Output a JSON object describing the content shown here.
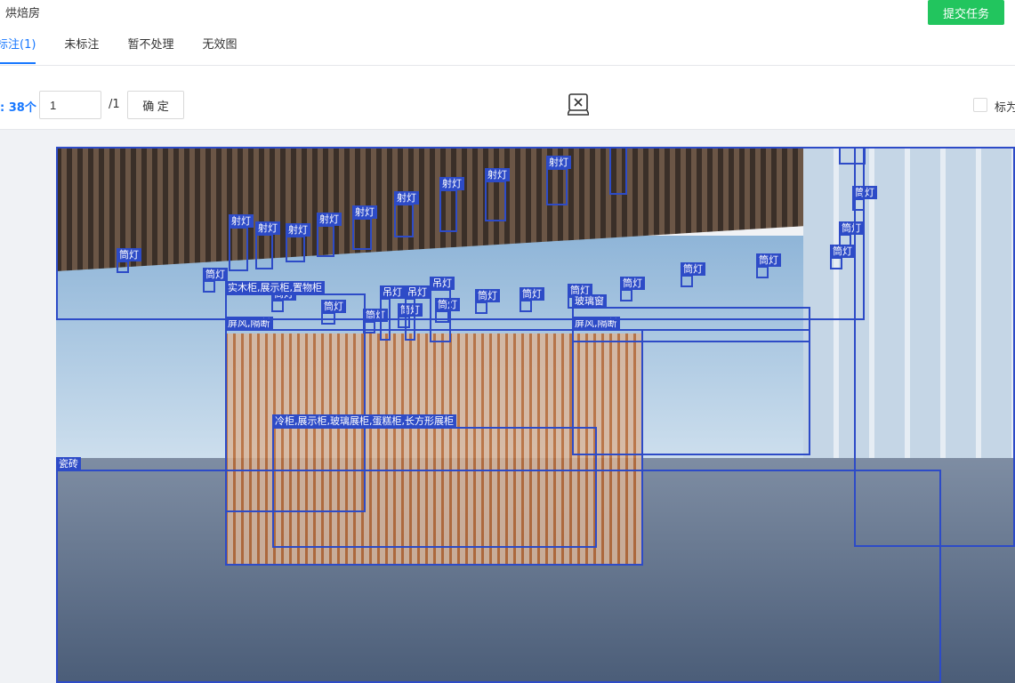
{
  "header": {
    "title": "烘焙房",
    "submit_label": "提交任务"
  },
  "tabs": [
    {
      "label": "标注(1)",
      "active": true
    },
    {
      "label": "未标注",
      "active": false
    },
    {
      "label": "暂不处理",
      "active": false
    },
    {
      "label": "无效图",
      "active": false
    }
  ],
  "toolbar": {
    "count_label": ": 38个",
    "page_value": "1",
    "page_total": "/1",
    "confirm_label": "确 定",
    "center_icon": "image-close-icon",
    "checkbox_label": "标为"
  },
  "colors": {
    "accent": "#1677ff",
    "submit": "#22c55e",
    "bbox": "#2d4bc7"
  },
  "annotations": [
    {
      "label": "射灯"
    },
    {
      "label": "射灯"
    },
    {
      "label": "射灯"
    },
    {
      "label": "射灯"
    },
    {
      "label": "射灯"
    },
    {
      "label": "射灯"
    },
    {
      "label": "射灯"
    },
    {
      "label": "射灯"
    },
    {
      "label": "射灯"
    },
    {
      "label": "射灯"
    },
    {
      "label": "射灯"
    },
    {
      "label": "筒灯"
    },
    {
      "label": "筒灯"
    },
    {
      "label": "筒灯"
    },
    {
      "label": "筒灯"
    },
    {
      "label": "筒灯"
    },
    {
      "label": "筒灯"
    },
    {
      "label": "筒灯"
    },
    {
      "label": "筒灯"
    },
    {
      "label": "筒灯"
    },
    {
      "label": "筒灯"
    },
    {
      "label": "筒灯"
    },
    {
      "label": "筒灯"
    },
    {
      "label": "筒灯"
    },
    {
      "label": "筒灯"
    },
    {
      "label": "筒灯"
    },
    {
      "label": "筒灯"
    },
    {
      "label": "吊灯"
    },
    {
      "label": "吊灯"
    },
    {
      "label": "吊灯"
    },
    {
      "label": "实木柜,展示柜,置物柜"
    },
    {
      "label": "屏风,隔断"
    },
    {
      "label": "屏风,隔断"
    },
    {
      "label": "玻璃窗"
    },
    {
      "label": "冷柜,展示柜,玻璃展柜,蛋糕柜,长方形展柜"
    },
    {
      "label": "瓷砖"
    },
    {
      "label": ""
    },
    {
      "label": ""
    }
  ]
}
